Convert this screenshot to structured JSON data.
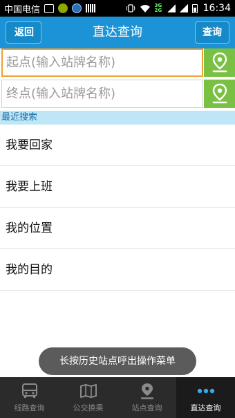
{
  "statusbar": {
    "carrier": "中国电信",
    "network": "3G 2G",
    "time": "16:34"
  },
  "header": {
    "back_label": "返回",
    "title": "直达查询",
    "query_label": "查询"
  },
  "form": {
    "start_placeholder": "起点(输入站牌名称)",
    "end_placeholder": "终点(输入站牌名称)"
  },
  "recent": {
    "heading": "最近搜索",
    "items": [
      {
        "label": "我要回家"
      },
      {
        "label": "我要上班"
      },
      {
        "label": "我的位置"
      },
      {
        "label": "我的目的"
      }
    ]
  },
  "toast": {
    "text": "长按历史站点呼出操作菜单"
  },
  "tabs": [
    {
      "label": "线路查询",
      "icon": "bus-icon",
      "active": false
    },
    {
      "label": "公交换乘",
      "icon": "map-icon",
      "active": false
    },
    {
      "label": "站点查询",
      "icon": "location-pin-icon",
      "active": false
    },
    {
      "label": "直达查询",
      "icon": "more-dots-icon",
      "active": true
    }
  ],
  "colors": {
    "header": "#1b93d6",
    "locate": "#7ac143",
    "focus_border": "#f0a030",
    "recent_bg": "#bfe6f7"
  }
}
